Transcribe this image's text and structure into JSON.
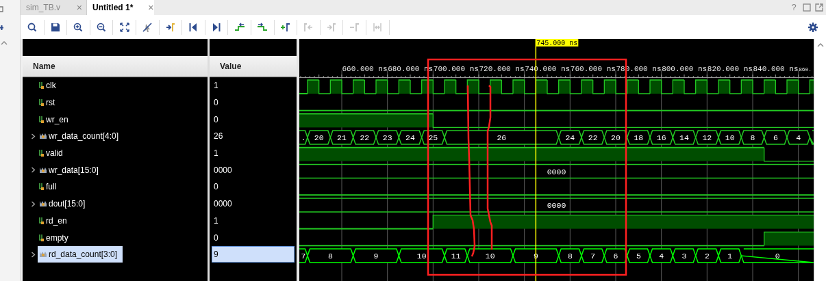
{
  "tabs": [
    {
      "label": "sim_TB.v",
      "selected": false,
      "close": "×"
    },
    {
      "label": "Untitled 1*",
      "selected": true,
      "close": "×"
    }
  ],
  "window_controls": [
    "?"
  ],
  "toolbar": [
    {
      "kind": "search",
      "disabled": false
    },
    {
      "kind": "save",
      "disabled": false
    },
    {
      "kind": "zoom-in",
      "disabled": false
    },
    {
      "kind": "zoom-out",
      "disabled": false
    },
    {
      "kind": "fit",
      "disabled": false
    },
    {
      "kind": "cursor-off",
      "disabled": false
    },
    {
      "kind": "to-cursor",
      "disabled": false
    },
    {
      "kind": "to-start",
      "disabled": false
    },
    {
      "kind": "to-end",
      "disabled": false
    },
    {
      "kind": "prev-edge",
      "disabled": false
    },
    {
      "kind": "next-edge",
      "disabled": false
    },
    {
      "kind": "add-marker",
      "disabled": false
    },
    {
      "kind": "prev-marker",
      "disabled": true
    },
    {
      "kind": "next-marker",
      "disabled": true
    },
    {
      "kind": "remove-marker",
      "disabled": true
    },
    {
      "kind": "swap-markers",
      "disabled": true
    }
  ],
  "columns": {
    "name": "Name",
    "value": "Value"
  },
  "ruler": {
    "labels": [
      "660.000 ns",
      "680.000 ns",
      "700.000 ns",
      "720.000 ns",
      "740.000 ns",
      "760.000 ns",
      "780.000 ns",
      "800.000 ns",
      "820.000 ns",
      "840.000 ns",
      "860."
    ]
  },
  "cursor": {
    "label": "745.000 ns"
  },
  "signals": [
    {
      "name": "clk",
      "value": "1",
      "kind": "bit",
      "selected": false,
      "segments": [
        {
          "high": false
        },
        {
          "high": true
        },
        {
          "high": false
        },
        {
          "high": true
        },
        {
          "high": false
        },
        {
          "high": true
        },
        {
          "high": false
        },
        {
          "high": true
        },
        {
          "high": false
        },
        {
          "high": true
        },
        {
          "high": false
        },
        {
          "high": true
        },
        {
          "high": false
        },
        {
          "high": true
        },
        {
          "high": false
        },
        {
          "high": true
        },
        {
          "high": false
        },
        {
          "high": true
        },
        {
          "high": false
        },
        {
          "high": true
        },
        {
          "high": false
        },
        {
          "high": true
        },
        {
          "high": false
        },
        {
          "high": true
        },
        {
          "high": false
        },
        {
          "high": true
        },
        {
          "high": false
        },
        {
          "high": true
        },
        {
          "high": false
        },
        {
          "high": true
        },
        {
          "high": false
        },
        {
          "high": true
        },
        {
          "high": false
        },
        {
          "high": true
        },
        {
          "high": false
        },
        {
          "high": true
        },
        {
          "high": false
        },
        {
          "high": true
        },
        {
          "high": false
        },
        {
          "high": true
        },
        {
          "high": false
        },
        {
          "high": true
        },
        {
          "high": false
        },
        {
          "high": true
        },
        {
          "high": false
        },
        {
          "high": true
        }
      ]
    },
    {
      "name": "rst",
      "value": "0",
      "kind": "bit",
      "selected": false,
      "segments": [
        {
          "high": false
        }
      ]
    },
    {
      "name": "wr_en",
      "value": "0",
      "kind": "bit",
      "selected": false,
      "segments": [
        {
          "high": true
        },
        {
          "high": false
        }
      ]
    },
    {
      "name": "wr_data_count[4:0]",
      "value": "26",
      "kind": "bus",
      "selected": false,
      "expanded": false,
      "segments": [
        {
          "value": "."
        },
        {
          "value": "20"
        },
        {
          "value": "21"
        },
        {
          "value": "22"
        },
        {
          "value": "23"
        },
        {
          "value": "24"
        },
        {
          "value": "25"
        },
        {
          "value": "26"
        },
        {
          "value": "24"
        },
        {
          "value": "22"
        },
        {
          "value": "20"
        },
        {
          "value": "18"
        },
        {
          "value": "16"
        },
        {
          "value": "14"
        },
        {
          "value": "12"
        },
        {
          "value": "10"
        },
        {
          "value": "8"
        },
        {
          "value": "6"
        },
        {
          "value": "4"
        }
      ]
    },
    {
      "name": "valid",
      "value": "1",
      "kind": "bit",
      "selected": false,
      "segments": [
        {
          "high": true
        },
        {
          "high": false
        }
      ]
    },
    {
      "name": "wr_data[15:0]",
      "value": "0000",
      "kind": "bus",
      "selected": false,
      "expanded": false,
      "segments": [
        {
          "value": "0000"
        }
      ]
    },
    {
      "name": "full",
      "value": "0",
      "kind": "bit",
      "selected": false,
      "segments": [
        {
          "high": false
        }
      ]
    },
    {
      "name": "dout[15:0]",
      "value": "0000",
      "kind": "bus",
      "selected": false,
      "expanded": false,
      "segments": [
        {
          "value": "0000"
        }
      ]
    },
    {
      "name": "rd_en",
      "value": "1",
      "kind": "bit",
      "selected": false,
      "segments": [
        {
          "high": false
        },
        {
          "high": true
        }
      ]
    },
    {
      "name": "empty",
      "value": "0",
      "kind": "bit",
      "selected": false,
      "segments": [
        {
          "high": false
        },
        {
          "high": true
        }
      ]
    },
    {
      "name": "rd_data_count[3:0]",
      "value": "9",
      "kind": "bus",
      "selected": true,
      "expanded": false,
      "segments": [
        {
          "value": "7"
        },
        {
          "value": "8"
        },
        {
          "value": "9"
        },
        {
          "value": "10"
        },
        {
          "value": "11"
        },
        {
          "value": "10"
        },
        {
          "value": "9"
        },
        {
          "value": "8"
        },
        {
          "value": "7"
        },
        {
          "value": "6"
        },
        {
          "value": "5"
        },
        {
          "value": "4"
        },
        {
          "value": "3"
        },
        {
          "value": "2"
        },
        {
          "value": "1"
        },
        {
          "value": "0"
        }
      ]
    }
  ],
  "hand_markup": true
}
